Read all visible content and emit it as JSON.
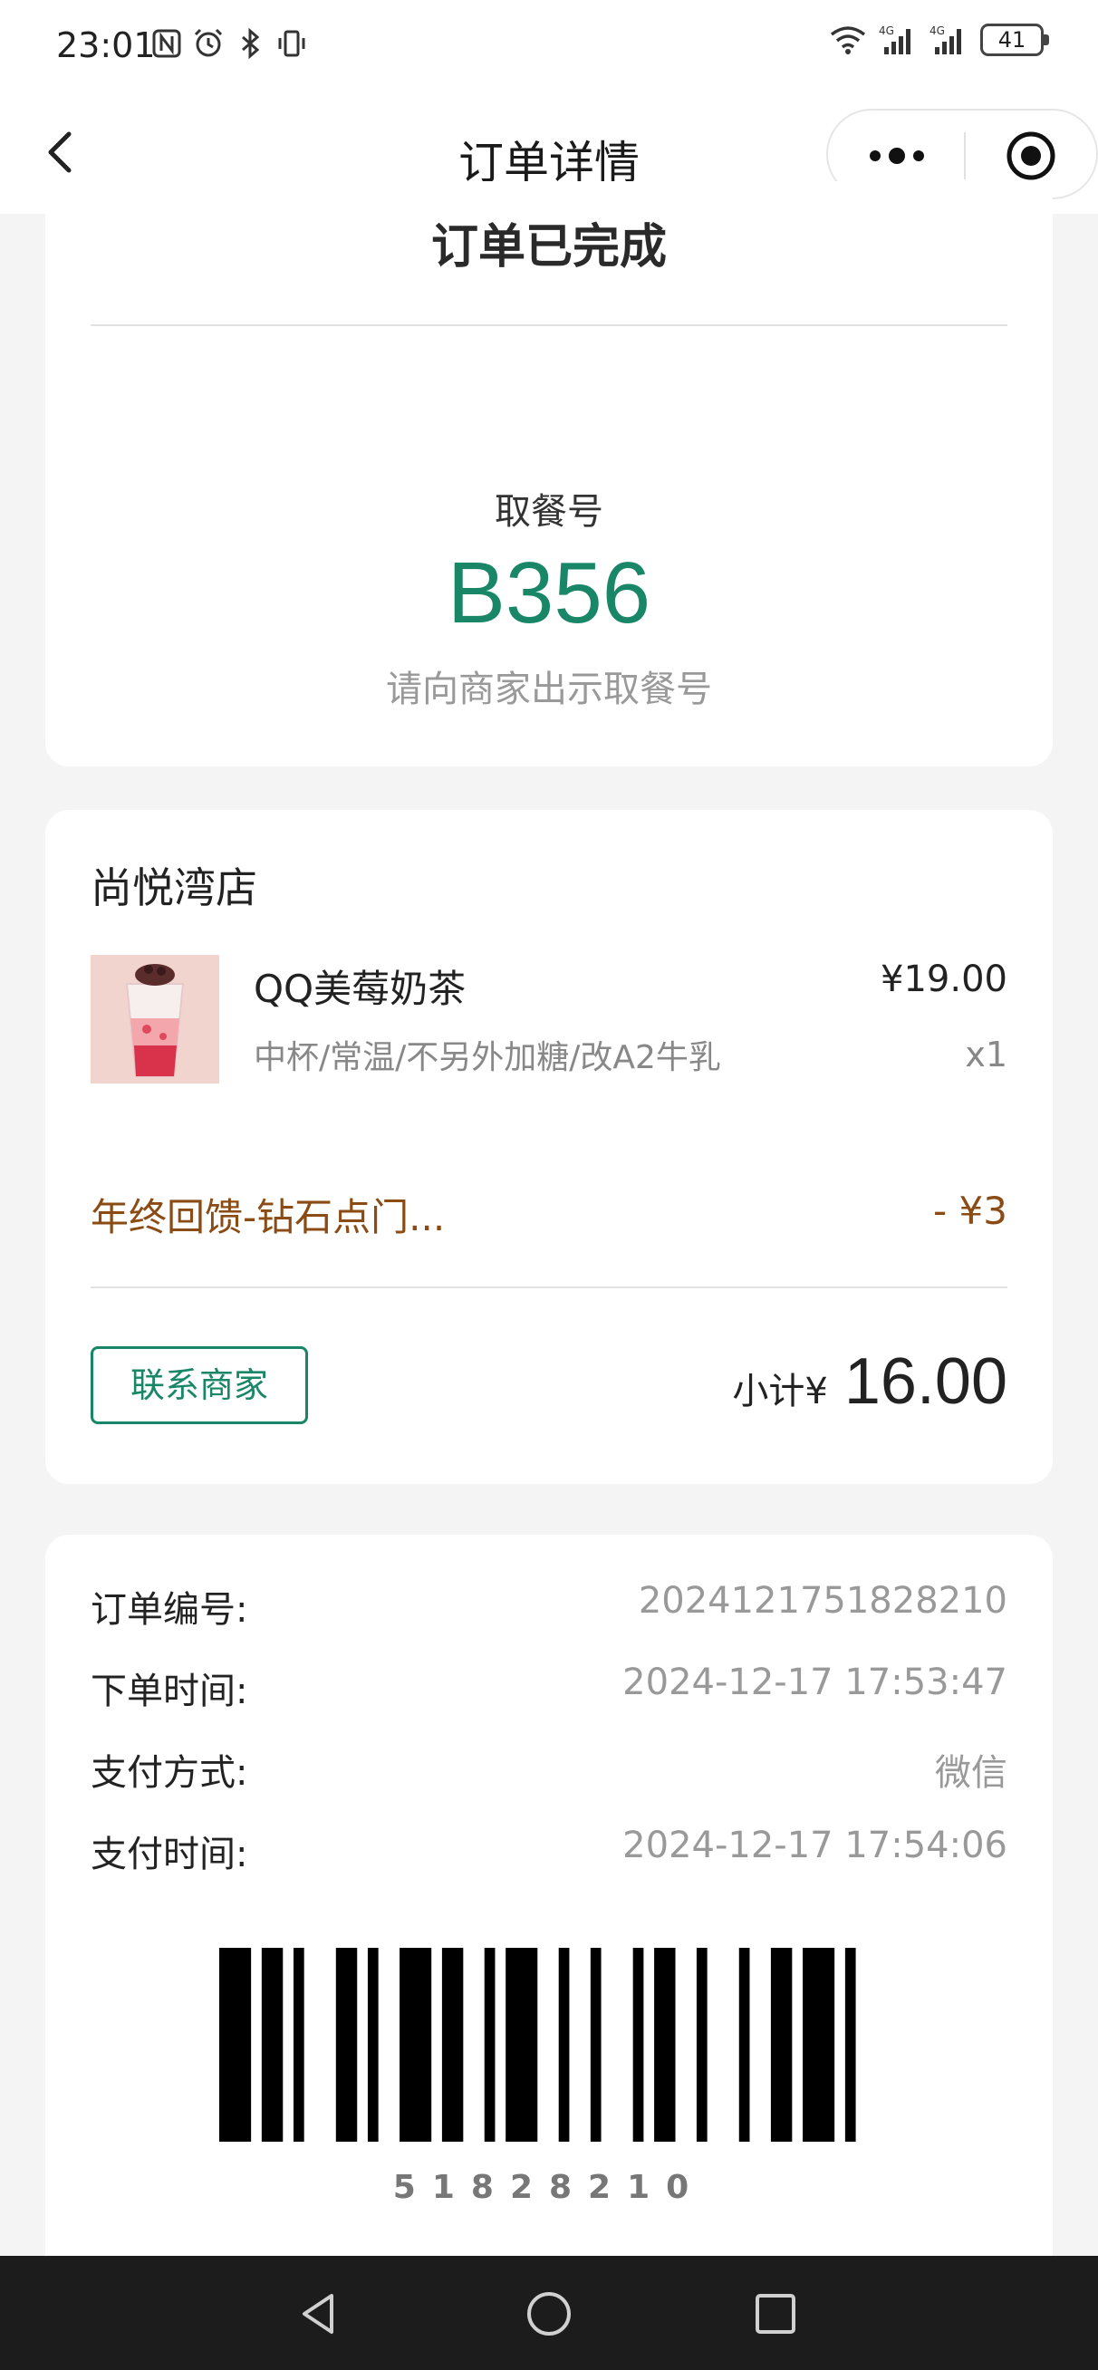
{
  "status_bar": {
    "time": "23:01",
    "left_icons": [
      "nfc-icon",
      "alarm-icon",
      "bluetooth-icon",
      "vibrate-icon"
    ],
    "right_icons": [
      "wifi-icon",
      "signal-4g-icon",
      "signal-4g-icon"
    ],
    "battery": "41"
  },
  "nav": {
    "title": "订单详情",
    "back_icon": "chevron-left-icon",
    "more_icon": "more-dots-icon",
    "close_icon": "target-circle-icon"
  },
  "order": {
    "status": "订单已完成",
    "pickup_label": "取餐号",
    "pickup_number": "B356",
    "pickup_hint": "请向商家出示取餐号"
  },
  "store": {
    "name": "尚悦湾店",
    "item": {
      "name": "QQ美莓奶茶",
      "price": "¥19.00",
      "spec": "中杯/常温/不另外加糖/改A2牛乳",
      "qty": "x1"
    },
    "discount": {
      "name": "年终回馈-钻石点门...",
      "amount": "- ¥3"
    },
    "contact_label": "联系商家",
    "subtotal_label": "小计¥",
    "subtotal_value": "16.00"
  },
  "info": {
    "rows": [
      {
        "label": "订单编号:",
        "value": "2024121751828210"
      },
      {
        "label": "下单时间:",
        "value": "2024-12-17 17:53:47"
      },
      {
        "label": "支付方式:",
        "value": "微信"
      },
      {
        "label": "支付时间:",
        "value": "2024-12-17 17:54:06"
      }
    ],
    "barcode_number": "51828210"
  },
  "colors": {
    "accent": "#1a8668",
    "discount": "#8a4b14",
    "muted": "#999999",
    "background": "#f4f4f4"
  }
}
